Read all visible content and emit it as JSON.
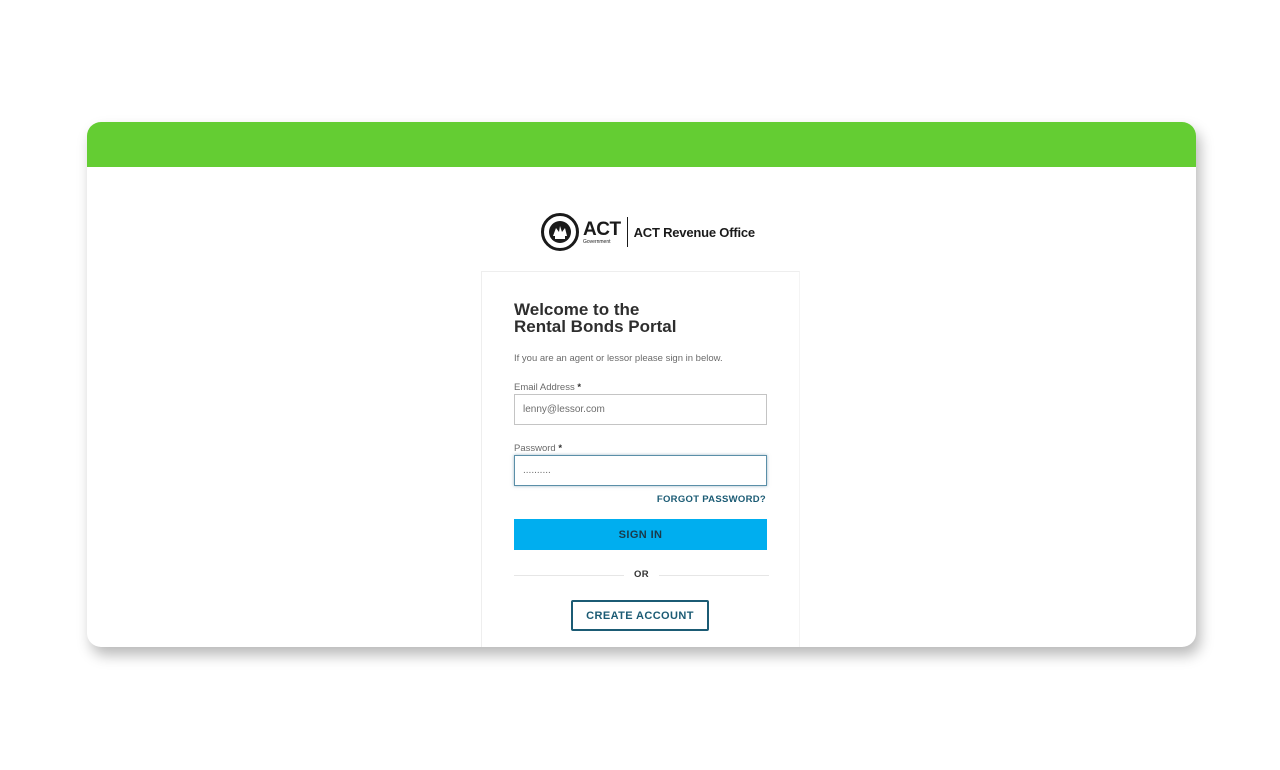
{
  "header": {
    "accent_color": "#64cd33"
  },
  "logo": {
    "brand": "ACT",
    "brand_sub": "Government",
    "office": "ACT Revenue Office"
  },
  "login": {
    "title_line1": "Welcome to the",
    "title_line2": "Rental Bonds Portal",
    "subtitle": "If you are an agent or lessor please sign in below.",
    "email_label": "Email Address",
    "email_value": "lenny@lessor.com",
    "password_label": "Password",
    "password_value": "..........",
    "required_marker": "*",
    "forgot_label": "FORGOT PASSWORD?",
    "signin_label": "SIGN IN",
    "or_label": "OR",
    "create_label": "CREATE ACCOUNT"
  },
  "colors": {
    "primary_button": "#00aeef",
    "link": "#1b5b74"
  }
}
